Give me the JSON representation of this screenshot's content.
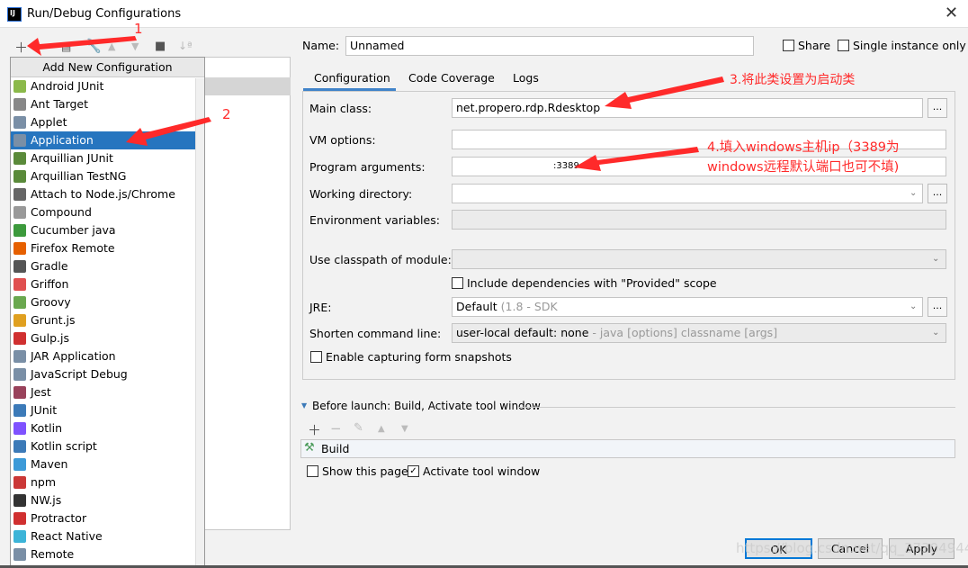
{
  "window": {
    "title": "Run/Debug Configurations",
    "logo": "IJ"
  },
  "toolbar": {
    "icons": [
      "plus-icon",
      "copy-icon",
      "wrench-icon",
      "arrow-up-icon",
      "arrow-down-icon",
      "new-folder-icon",
      "sort-icon"
    ]
  },
  "popup": {
    "header": "Add New Configuration",
    "selected": "Application",
    "items": [
      {
        "label": "Android JUnit",
        "color": "#8bb94a"
      },
      {
        "label": "Ant Target",
        "color": "#888"
      },
      {
        "label": "Applet",
        "color": "#7a8fa6"
      },
      {
        "label": "Application",
        "color": "#7a8fa6"
      },
      {
        "label": "Arquillian JUnit",
        "color": "#5a8a3a"
      },
      {
        "label": "Arquillian TestNG",
        "color": "#5a8a3a"
      },
      {
        "label": "Attach to Node.js/Chrome",
        "color": "#666"
      },
      {
        "label": "Compound",
        "color": "#999"
      },
      {
        "label": "Cucumber java",
        "color": "#3c9a3c"
      },
      {
        "label": "Firefox Remote",
        "color": "#e66000"
      },
      {
        "label": "Gradle",
        "color": "#555"
      },
      {
        "label": "Griffon",
        "color": "#e05050"
      },
      {
        "label": "Groovy",
        "color": "#6aa84f"
      },
      {
        "label": "Grunt.js",
        "color": "#e0a020"
      },
      {
        "label": "Gulp.js",
        "color": "#d03030"
      },
      {
        "label": "JAR Application",
        "color": "#7a8fa6"
      },
      {
        "label": "JavaScript Debug",
        "color": "#7a8fa6"
      },
      {
        "label": "Jest",
        "color": "#99425b"
      },
      {
        "label": "JUnit",
        "color": "#3c7ab8"
      },
      {
        "label": "Kotlin",
        "color": "#7f52ff"
      },
      {
        "label": "Kotlin script",
        "color": "#3c7ab8"
      },
      {
        "label": "Maven",
        "color": "#3c9ad8"
      },
      {
        "label": "npm",
        "color": "#cb3837"
      },
      {
        "label": "NW.js",
        "color": "#333"
      },
      {
        "label": "Protractor",
        "color": "#d03030"
      },
      {
        "label": "React Native",
        "color": "#3cb4d8"
      },
      {
        "label": "Remote",
        "color": "#7a8fa6"
      }
    ]
  },
  "form": {
    "name_label": "Name:",
    "name_value": "Unnamed",
    "share": "Share",
    "single_instance": "Single instance only",
    "tabs": [
      "Configuration",
      "Code Coverage",
      "Logs"
    ],
    "main_class_label": "Main class:",
    "main_class": "net.propero.rdp.Rdesktop",
    "vm_label": "VM options:",
    "args_label": "Program arguments:",
    "args_value": ":3389",
    "workdir_label": "Working directory:",
    "env_label": "Environment variables:",
    "classpath_label": "Use classpath of module:",
    "include_deps": "Include dependencies with \"Provided\" scope",
    "jre_label": "JRE:",
    "jre_value": "Default",
    "jre_hint": "(1.8 - SDK",
    "shorten_label": "Shorten command line:",
    "shorten_value": "user-local default: none",
    "shorten_hint": "- java [options] classname [args]",
    "snapshots": "Enable capturing form snapshots",
    "before_launch": "Before launch: Build, Activate tool window",
    "build_item": "Build",
    "show_page": "Show this page",
    "activate_tool": "Activate tool window",
    "more": "..."
  },
  "buttons": {
    "ok": "OK",
    "cancel": "Cancel",
    "apply": "Apply"
  },
  "annotations": {
    "a1": "1",
    "a2": "2",
    "a3": "3.将此类设置为启动类",
    "a4_line1": "4.填入windows主机ip（3389为",
    "a4_line2": "windows远程默认端口也可不填)",
    "color": "#ff2a2a"
  },
  "watermark": "https://blog.csdn.net/qq_37304944"
}
